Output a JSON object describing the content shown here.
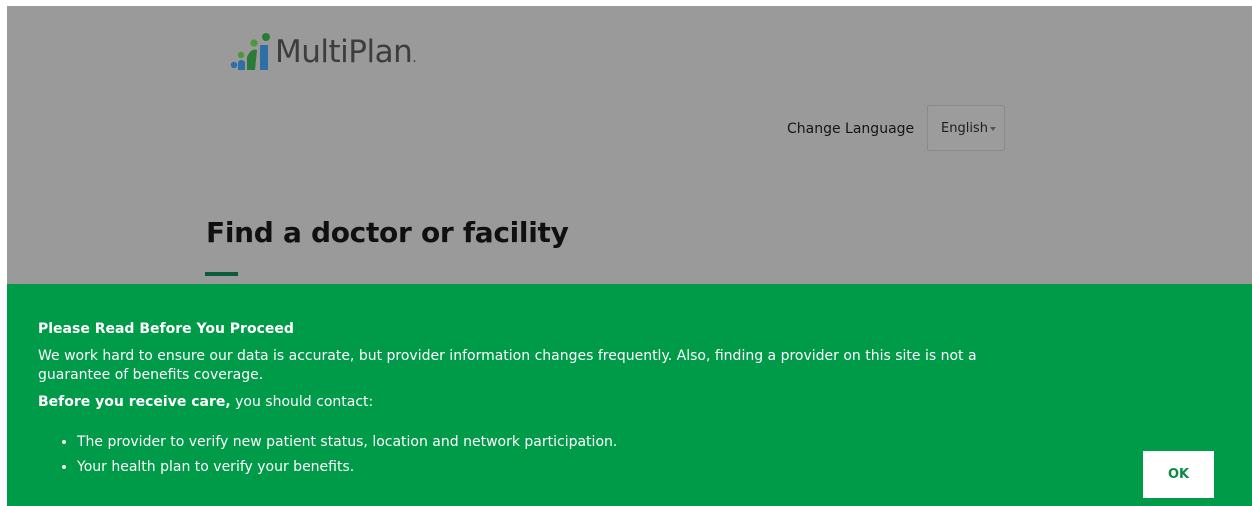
{
  "header": {
    "logo_text": "MultiPlan",
    "logo_mark": "."
  },
  "language": {
    "label": "Change Language",
    "selected": "English"
  },
  "main": {
    "title": "Find a doctor or facility"
  },
  "notice": {
    "heading": "Please Read Before You Proceed",
    "body": "We work hard to ensure our data is accurate, but provider information changes frequently. Also, finding a provider on this site is not a guarantee of benefits coverage.",
    "contact_bold": "Before you receive care,",
    "contact_rest": " you should contact:",
    "items": [
      "The provider to verify new patient status, location and network participation.",
      "Your health plan to verify your benefits."
    ],
    "ok_label": "OK"
  },
  "colors": {
    "brand_green": "#009b48",
    "overlay_gray": "#9a9a9a",
    "underline_green": "#0d5c39"
  }
}
